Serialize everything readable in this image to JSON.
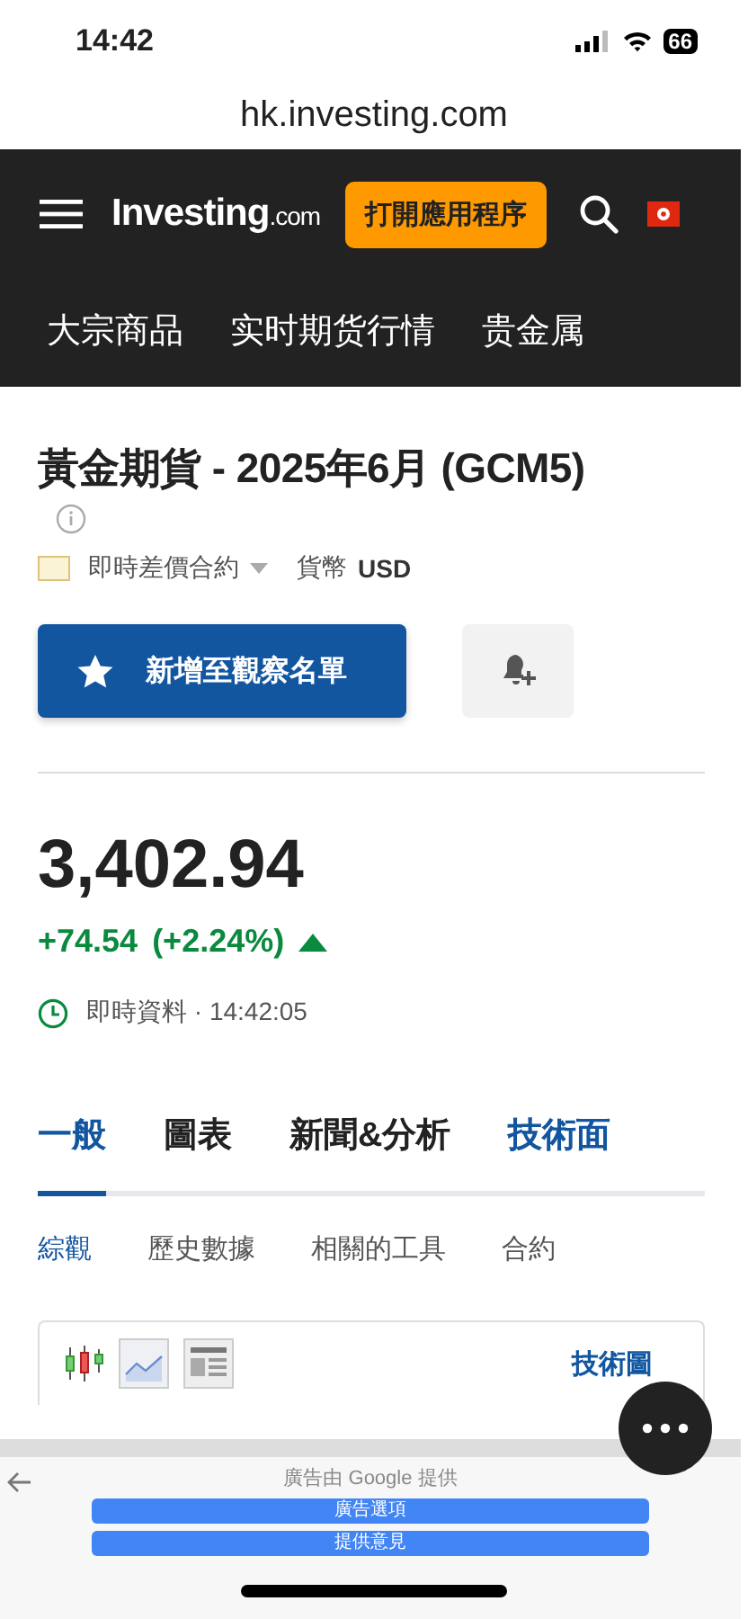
{
  "status_bar": {
    "time": "14:42",
    "battery": "66"
  },
  "browser": {
    "url": "hk.investing.com"
  },
  "header": {
    "logo": "Investing",
    "logo_suffix": ".com",
    "open_app_button": "打開應用程序"
  },
  "category_nav": [
    {
      "label": "大宗商品"
    },
    {
      "label": "实时期货行情"
    },
    {
      "label": "贵金属"
    }
  ],
  "instrument": {
    "title": "黃金期貨 - 2025年6月 (GCM5)",
    "contract_type": "即時差價合約",
    "currency_label": "貨幣",
    "currency": "USD"
  },
  "watchlist_button": "新增至觀察名單",
  "quote": {
    "price": "3,402.94",
    "change": "+74.54",
    "change_percent": "(+2.24%)",
    "rising": true,
    "status": "即時資料 · 14:42:05"
  },
  "tabs": [
    {
      "label": "一般",
      "selected": true,
      "accent": false
    },
    {
      "label": "圖表",
      "selected": false,
      "accent": false
    },
    {
      "label": "新聞&分析",
      "selected": false,
      "accent": false
    },
    {
      "label": "技術面",
      "selected": false,
      "accent": true
    }
  ],
  "subtabs": [
    {
      "label": "綜觀",
      "selected": true
    },
    {
      "label": "歷史數據",
      "selected": false
    },
    {
      "label": "相關的工具",
      "selected": false
    },
    {
      "label": "合約",
      "selected": false
    }
  ],
  "chart_toolbar": {
    "link": "技術圖"
  },
  "ad": {
    "caption": "廣告由 Google 提供",
    "buttons": [
      "廣告選項",
      "提供意見"
    ]
  }
}
